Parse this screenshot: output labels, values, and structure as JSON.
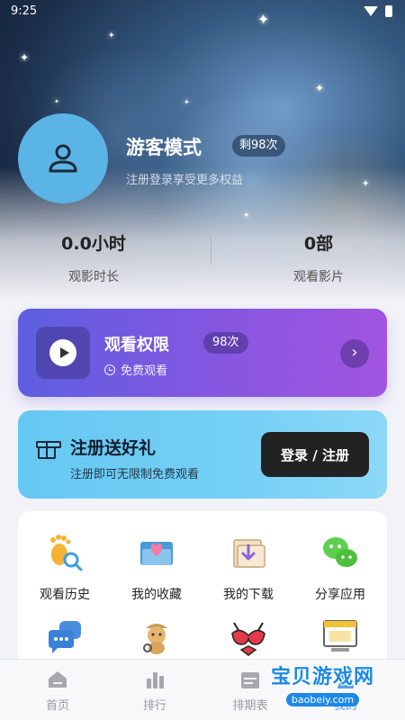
{
  "status_bar": {
    "time": "9:25"
  },
  "profile": {
    "name": "游客模式",
    "remaining_badge": "剩98次",
    "subtitle": "注册登录享受更多权益",
    "avatar_icon": "user-icon"
  },
  "stats": [
    {
      "value": "0.0小时",
      "label": "观影时长"
    },
    {
      "value": "0部",
      "label": "观看影片"
    }
  ],
  "watch_card": {
    "title": "观看权限",
    "badge": "98次",
    "subtitle": "免费观看",
    "icon": "play-icon"
  },
  "register_card": {
    "title": "注册送好礼",
    "subtitle": "注册即可无限制免费观看",
    "button": "登录 / 注册",
    "icon": "gift-icon"
  },
  "grid": [
    {
      "label": "观看历史",
      "icon": "footprint-icon"
    },
    {
      "label": "我的收藏",
      "icon": "heart-folder-icon"
    },
    {
      "label": "我的下载",
      "icon": "download-folder-icon"
    },
    {
      "label": "分享应用",
      "icon": "wechat-icon"
    },
    {
      "label": "",
      "icon": "chat-bubble-icon"
    },
    {
      "label": "",
      "icon": "detective-dog-icon"
    },
    {
      "label": "",
      "icon": "bra-icon"
    },
    {
      "label": "",
      "icon": "browser-window-icon"
    }
  ],
  "bottom_nav": [
    {
      "label": "首页",
      "icon": "home-icon"
    },
    {
      "label": "排行",
      "icon": "ranking-icon"
    },
    {
      "label": "排期表",
      "icon": "schedule-icon"
    },
    {
      "label": "我的",
      "icon": "profile-icon"
    }
  ],
  "watermark": {
    "text": "宝贝游戏网",
    "url": "baobeiy.com"
  },
  "colors": {
    "watch_card_start": "#5d5fe0",
    "watch_card_end": "#a155e0",
    "register_card": "#72cdf5",
    "avatar": "#5ab4e6",
    "button_dark": "#222222"
  }
}
